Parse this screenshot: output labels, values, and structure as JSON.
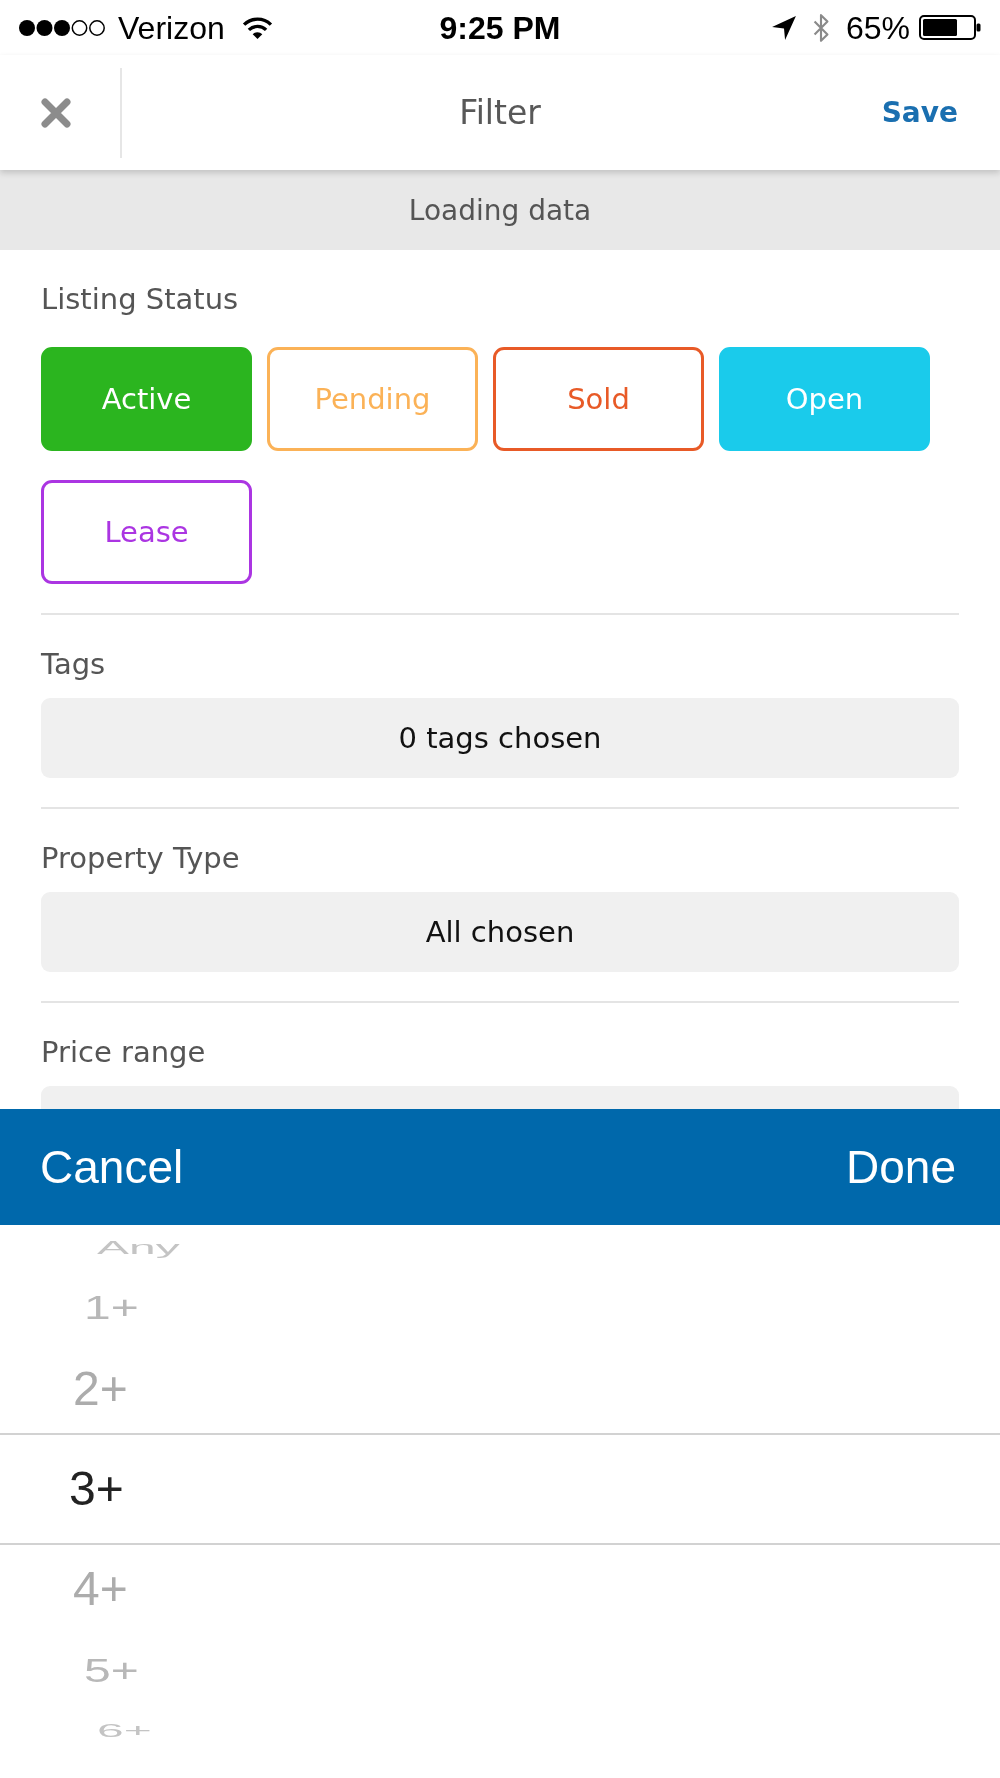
{
  "status_bar": {
    "carrier": "Verizon",
    "time": "9:25 PM",
    "battery": "65%"
  },
  "header": {
    "title": "Filter",
    "action": "Save"
  },
  "banner": {
    "text": "Loading data"
  },
  "listing_status": {
    "label": "Listing Status",
    "options": [
      {
        "label": "Active",
        "color": "#2bb51f",
        "selected": true
      },
      {
        "label": "Pending",
        "color": "#fbb257",
        "selected": false
      },
      {
        "label": "Sold",
        "color": "#e85a27",
        "selected": false
      },
      {
        "label": "Open",
        "color": "#1acbeb",
        "selected": true
      },
      {
        "label": "Lease",
        "color": "#ab35e2",
        "selected": false
      }
    ]
  },
  "fields": [
    {
      "label": "Tags",
      "value": "0 tags chosen"
    },
    {
      "label": "Property Type",
      "value": "All chosen"
    },
    {
      "label": "Price range"
    }
  ],
  "picker": {
    "cancel": "Cancel",
    "done": "Done",
    "items": [
      {
        "label": "Any",
        "selected": false
      },
      {
        "label": "1+",
        "selected": false
      },
      {
        "label": "2+",
        "selected": false
      },
      {
        "label": "3+",
        "selected": true
      },
      {
        "label": "4+",
        "selected": false
      },
      {
        "label": "5+",
        "selected": false
      },
      {
        "label": "6+",
        "selected": false
      }
    ]
  }
}
